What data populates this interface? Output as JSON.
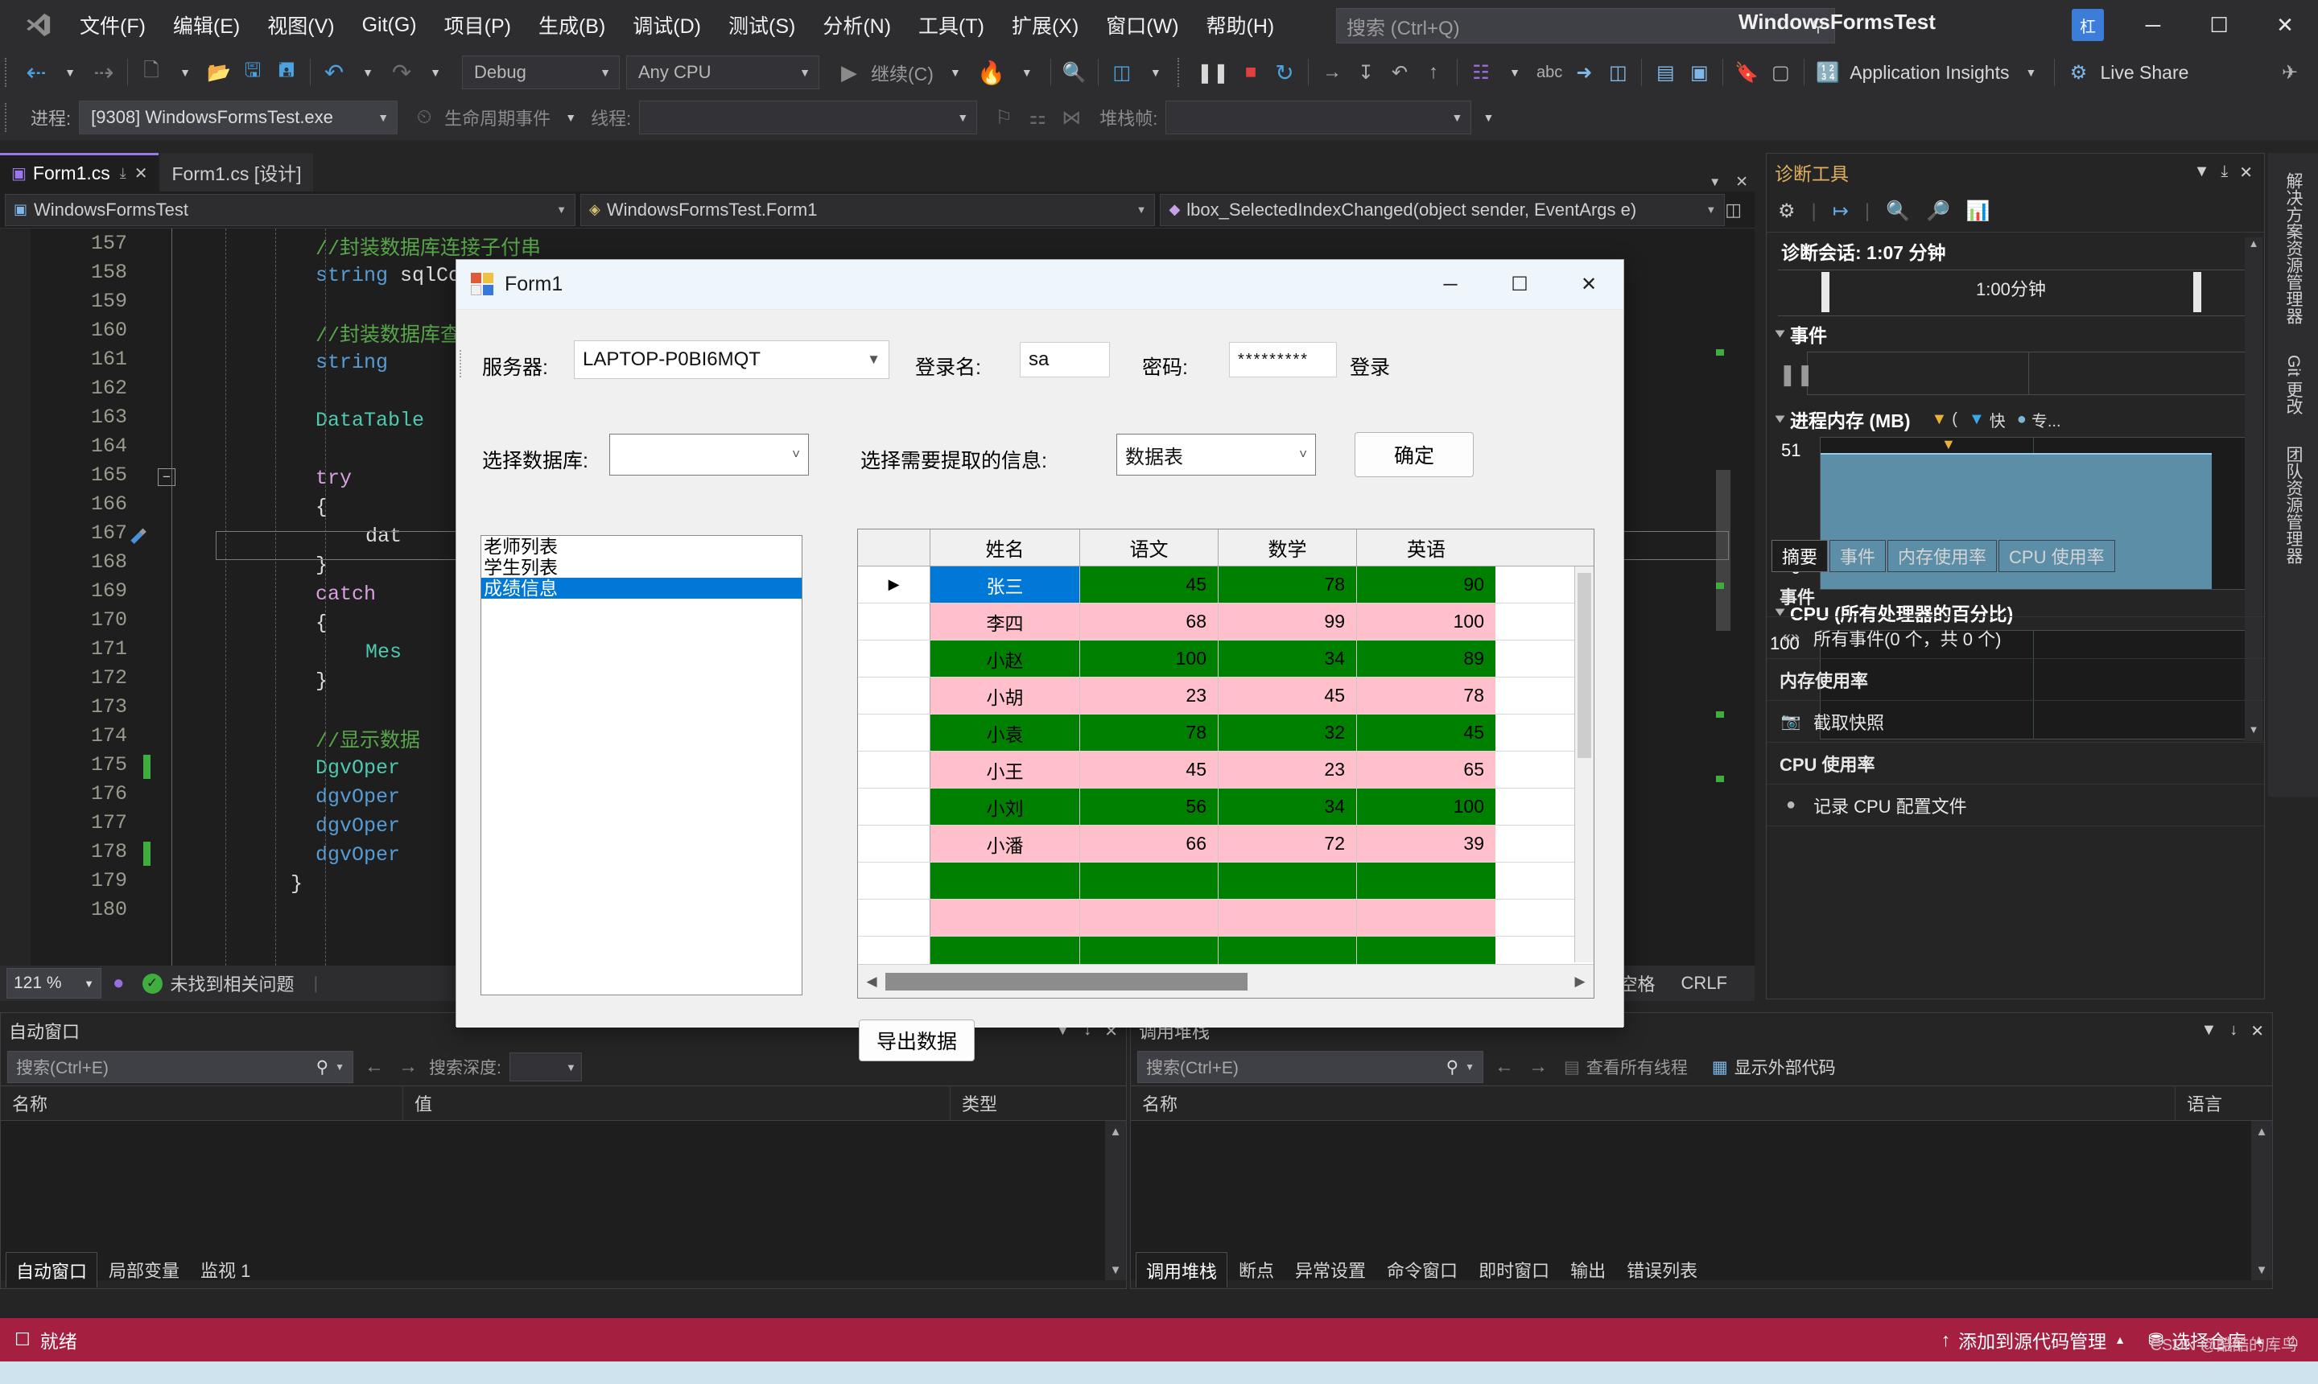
{
  "titlebar": {
    "app_title": "WindowsFormsTest",
    "logo": "vs-logo",
    "menu": [
      {
        "label": "文件(F)"
      },
      {
        "label": "编辑(E)"
      },
      {
        "label": "视图(V)"
      },
      {
        "label": "Git(G)"
      },
      {
        "label": "项目(P)"
      },
      {
        "label": "生成(B)"
      },
      {
        "label": "调试(D)"
      },
      {
        "label": "测试(S)"
      },
      {
        "label": "分析(N)"
      },
      {
        "label": "工具(T)"
      },
      {
        "label": "扩展(X)"
      },
      {
        "label": "窗口(W)"
      },
      {
        "label": "帮助(H)"
      }
    ],
    "search_placeholder": "搜索 (Ctrl+Q)",
    "avatar_initial": "杠",
    "minimize": "─",
    "maximize": "☐",
    "close": "✕"
  },
  "toolbar1": {
    "nav_back": "←",
    "nav_forward": "→",
    "new_item": "new-item-icon",
    "open_file": "open-file-icon",
    "save": "save-icon",
    "save_all": "save-all-icon",
    "undo": "↶",
    "redo": "↷",
    "config": "Debug",
    "platform": "Any CPU",
    "continue_label": "继续(C)",
    "hot_reload": "hot-reload-icon",
    "attach": "attach-icon",
    "window_layout": "window-layout-icon",
    "pause": "pause-icon",
    "stop": "stop-icon",
    "restart": "restart-icon",
    "step_over": "→",
    "step_into": "↓",
    "step_out": "↑",
    "show_next": "show-next-statement-icon",
    "abc": "abc",
    "pointer": "pointer-icon",
    "bookmark": "bookmark-icon",
    "app_insights": "Application Insights",
    "live_share": "Live Share"
  },
  "toolbar2": {
    "process_label": "进程:",
    "process_value": "[9308] WindowsFormsTest.exe",
    "lifecycle_label": "生命周期事件",
    "thread_label": "线程:",
    "thread_value": "",
    "stackframe_label": "堆栈帧:",
    "stackframe_value": ""
  },
  "tabs": [
    {
      "label": "Form1.cs",
      "active": true,
      "pin": "⤓",
      "close": "✕"
    },
    {
      "label": "Form1.cs [设计]",
      "active": false
    }
  ],
  "navbar": {
    "project": "WindowsFormsTest",
    "type": "WindowsFormsTest.Form1",
    "member": "lbox_SelectedIndexChanged(object sender, EventArgs e)",
    "split_icon": "split-view-icon"
  },
  "editor": {
    "lines": [
      {
        "num": "157",
        "indent": 4,
        "text": "//封装数据库连接子付串",
        "cls": "c-com",
        "changed": false
      },
      {
        "num": "158",
        "indent": 4,
        "text": "string",
        "cls": "c-kw",
        "changed": false,
        "tail": " sqlCon = \"Data Source=\" + txtServer.Text + \";Pwd",
        "tailcls": "c-pln"
      },
      {
        "num": "159",
        "indent": 4,
        "text": "",
        "cls": "c-pln",
        "changed": false
      },
      {
        "num": "160",
        "indent": 4,
        "text": "//封装数据库查询语句",
        "cls": "c-com",
        "changed": false
      },
      {
        "num": "161",
        "indent": 4,
        "text": "string",
        "cls": "c-kw",
        "changed": false
      },
      {
        "num": "162",
        "indent": 4,
        "text": "",
        "cls": "c-pln",
        "changed": false
      },
      {
        "num": "163",
        "indent": 4,
        "text": "DataTable",
        "cls": "c-typ",
        "changed": false
      },
      {
        "num": "164",
        "indent": 4,
        "text": "",
        "cls": "c-pln",
        "changed": false
      },
      {
        "num": "165",
        "indent": 4,
        "text": "try",
        "cls": "c-ctl",
        "changed": false,
        "fold": true
      },
      {
        "num": "166",
        "indent": 4,
        "text": "{",
        "cls": "c-pln",
        "changed": false
      },
      {
        "num": "167",
        "indent": 6,
        "text": "dat",
        "cls": "c-pln",
        "changed": false,
        "bp": true
      },
      {
        "num": "168",
        "indent": 4,
        "text": "}",
        "cls": "c-pln",
        "changed": false
      },
      {
        "num": "169",
        "indent": 4,
        "text": "catch",
        "cls": "c-ctl",
        "changed": false
      },
      {
        "num": "170",
        "indent": 4,
        "text": "{",
        "cls": "c-pln",
        "changed": false
      },
      {
        "num": "171",
        "indent": 6,
        "text": "Mes",
        "cls": "c-typ",
        "changed": false
      },
      {
        "num": "172",
        "indent": 4,
        "text": "}",
        "cls": "c-pln",
        "changed": false
      },
      {
        "num": "173",
        "indent": 4,
        "text": "",
        "cls": "c-pln",
        "changed": false
      },
      {
        "num": "174",
        "indent": 4,
        "text": "//显示数据",
        "cls": "c-com",
        "changed": false
      },
      {
        "num": "175",
        "indent": 4,
        "text": "DgvOper",
        "cls": "c-typ",
        "changed": true
      },
      {
        "num": "176",
        "indent": 4,
        "text": "dgvOper",
        "cls": "c-kw",
        "changed": false
      },
      {
        "num": "177",
        "indent": 4,
        "text": "dgvOper",
        "cls": "c-kw",
        "changed": false
      },
      {
        "num": "178",
        "indent": 4,
        "text": "dgvOper",
        "cls": "c-kw",
        "changed": true
      },
      {
        "num": "179",
        "indent": 3,
        "text": "}",
        "cls": "c-pln",
        "changed": false
      },
      {
        "num": "180",
        "indent": 2,
        "text": "",
        "cls": "c-pln",
        "changed": false
      }
    ]
  },
  "editor_status": {
    "zoom": "121 %",
    "issue_text": "未找到相关问题",
    "spaces": "空格",
    "eol": "CRLF"
  },
  "right_vtabs": [
    {
      "label": "解决方案资源管理器"
    },
    {
      "label": "Git 更改"
    },
    {
      "label": "团队资源管理器"
    }
  ],
  "diagnostics": {
    "title": "诊断工具",
    "toolbar_icons": [
      "gear-icon",
      "export-icon",
      "zoom-in-icon",
      "zoom-out-icon",
      "chart-icon"
    ],
    "dropdown": "▼",
    "pin": "⤓",
    "close": "✕",
    "session": "诊断会话: 1:07 分钟",
    "timeline_label": "1:00分钟",
    "events_section": "事件",
    "memory_section": "进程内存 (MB)",
    "memory_legend": [
      {
        "glyph": "▼",
        "color": "#e8b23a",
        "text": "("
      },
      {
        "glyph": "▼",
        "color": "#3aa8e8",
        "text": "快"
      },
      {
        "glyph": "●",
        "color": "#7fb5cf",
        "text": "专..."
      }
    ],
    "memory_max": "51",
    "memory_min": "0",
    "cpu_section": "CPU (所有处理器的百分比)",
    "cpu_max": "100",
    "cpu_min": "0",
    "tabs": [
      {
        "label": "摘要",
        "active": true
      },
      {
        "label": "事件",
        "active": false
      },
      {
        "label": "内存使用率",
        "active": false
      },
      {
        "label": "CPU 使用率",
        "active": false
      }
    ],
    "summary_rows": [
      {
        "label": "事件",
        "header": true
      },
      {
        "label": "所有事件(0 个，共 0 个)",
        "header": false,
        "icon": "«»"
      },
      {
        "label": "内存使用率",
        "header": true
      },
      {
        "label": "截取快照",
        "header": false,
        "icon": "▣"
      },
      {
        "label": "CPU 使用率",
        "header": true
      },
      {
        "label": "记录 CPU 配置文件",
        "header": false,
        "icon": "●"
      }
    ]
  },
  "autos_panel": {
    "title": "自动窗口",
    "search_placeholder": "搜索(Ctrl+E)",
    "depth_label": "搜索深度:",
    "depth_value": "",
    "columns": [
      "名称",
      "值",
      "类型"
    ],
    "tabs": [
      {
        "label": "自动窗口",
        "active": true
      },
      {
        "label": "局部变量",
        "active": false
      },
      {
        "label": "监视 1",
        "active": false
      }
    ]
  },
  "callstack_panel": {
    "title": "调用堆栈",
    "search_placeholder": "搜索(Ctrl+E)",
    "all_threads": "查看所有线程",
    "external_code": "显示外部代码",
    "columns": [
      "名称",
      "语言"
    ],
    "tabs": [
      {
        "label": "调用堆栈",
        "active": true
      },
      {
        "label": "断点",
        "active": false
      },
      {
        "label": "异常设置",
        "active": false
      },
      {
        "label": "命令窗口",
        "active": false
      },
      {
        "label": "即时窗口",
        "active": false
      },
      {
        "label": "输出",
        "active": false
      },
      {
        "label": "错误列表",
        "active": false
      }
    ]
  },
  "statusbar": {
    "state": "就绪",
    "source_control": "添加到源代码管理",
    "repo": "选择仓库",
    "bell": "⌂",
    "watermark": "CSDN @酷酷的库鸟"
  },
  "form": {
    "title": "Form1",
    "minimize": "─",
    "maximize": "☐",
    "close": "✕",
    "server_label": "服务器:",
    "server_value": "LAPTOP-P0BI6MQT",
    "login_label": "登录名:",
    "login_value": "sa",
    "password_label": "密码:",
    "password_value": "*********",
    "login_button": "登录",
    "db_label": "选择数据库:",
    "db_value": "",
    "info_label": "选择需要提取的信息:",
    "info_value": "数据表",
    "confirm_button": "确定",
    "export_button": "导出数据",
    "list_items": [
      {
        "label": "老师列表",
        "selected": false
      },
      {
        "label": "学生列表",
        "selected": false
      },
      {
        "label": "成绩信息",
        "selected": true
      }
    ],
    "grid": {
      "columns": [
        "姓名",
        "语文",
        "数学",
        "英语"
      ],
      "rows": [
        {
          "values": [
            "张三",
            "45",
            "78",
            "90"
          ],
          "color": "#008000",
          "current": true,
          "name_selected": true
        },
        {
          "values": [
            "李四",
            "68",
            "99",
            "100"
          ],
          "color": "#ffc0cb",
          "current": false,
          "name_selected": false
        },
        {
          "values": [
            "小赵",
            "100",
            "34",
            "89"
          ],
          "color": "#008000",
          "current": false,
          "name_selected": false
        },
        {
          "values": [
            "小胡",
            "23",
            "45",
            "78"
          ],
          "color": "#ffc0cb",
          "current": false,
          "name_selected": false
        },
        {
          "values": [
            "小袁",
            "78",
            "32",
            "45"
          ],
          "color": "#008000",
          "current": false,
          "name_selected": false
        },
        {
          "values": [
            "小王",
            "45",
            "23",
            "65"
          ],
          "color": "#ffc0cb",
          "current": false,
          "name_selected": false
        },
        {
          "values": [
            "小刘",
            "56",
            "34",
            "100"
          ],
          "color": "#008000",
          "current": false,
          "name_selected": false
        },
        {
          "values": [
            "小潘",
            "66",
            "72",
            "39"
          ],
          "color": "#ffc0cb",
          "current": false,
          "name_selected": false
        },
        {
          "values": [
            "",
            "",
            "",
            ""
          ],
          "color": "#008000",
          "current": false,
          "name_selected": false
        },
        {
          "values": [
            "",
            "",
            "",
            ""
          ],
          "color": "#ffc0cb",
          "current": false,
          "name_selected": false
        },
        {
          "values": [
            "",
            "",
            "",
            ""
          ],
          "color": "#008000",
          "current": false,
          "name_selected": false
        }
      ]
    }
  },
  "colors": {
    "accent": "#9c77e8",
    "status_bar": "#a52040",
    "selection_blue": "#0078d7",
    "grid_green": "#008000",
    "grid_pink": "#ffc0cb"
  }
}
